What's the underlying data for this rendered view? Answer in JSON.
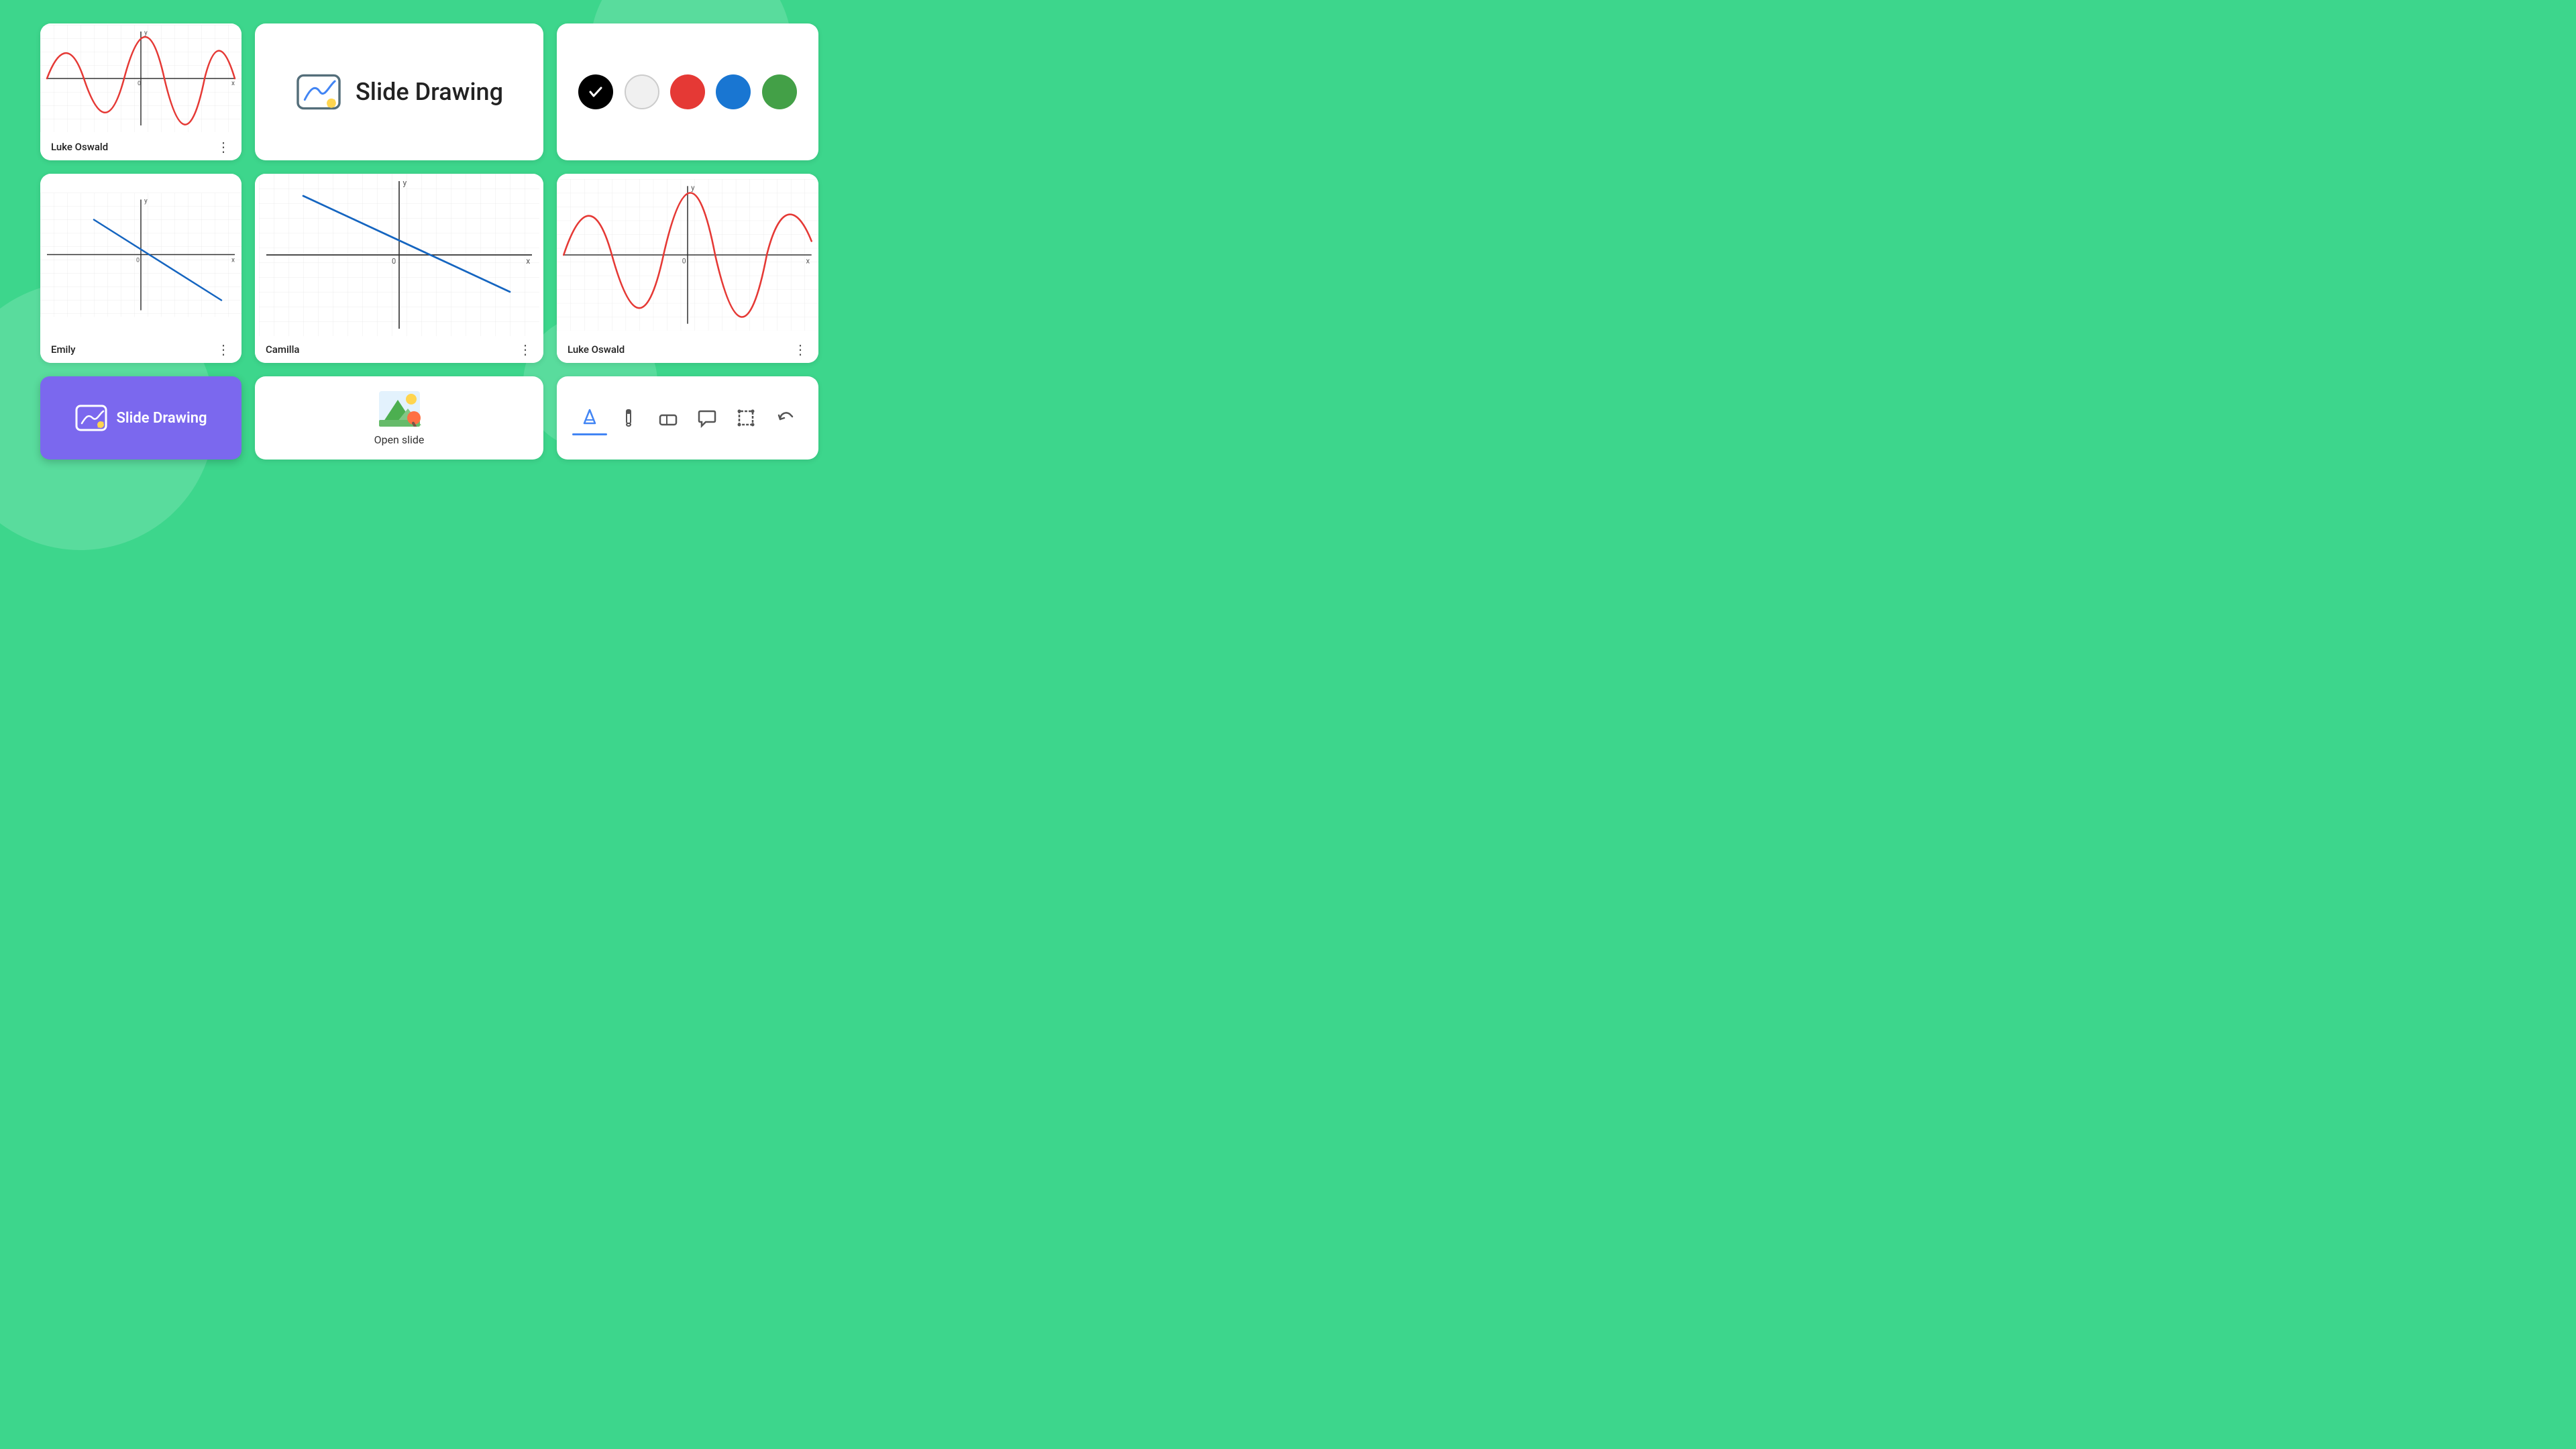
{
  "background_color": "#3dd68c",
  "cards": {
    "luke_oswald_small": {
      "name": "Luke Oswald",
      "graph_type": "sine_wave",
      "color": "#e53935"
    },
    "emily": {
      "name": "Emily",
      "graph_type": "linear_negative",
      "color": "#1565C0"
    },
    "slide_drawing_header": {
      "title": "Slide Drawing"
    },
    "camilla": {
      "name": "Camilla",
      "graph_type": "linear_negative",
      "color": "#1565C0"
    },
    "open_slide": {
      "label": "Open slide"
    },
    "color_picker": {
      "colors": [
        "#000000",
        "#e8e8e8",
        "#e53935",
        "#1976D2",
        "#43A047"
      ],
      "selected_index": 0
    },
    "luke_oswald_large": {
      "name": "Luke Oswald",
      "graph_type": "sine_wave",
      "color": "#e53935"
    },
    "tools": {
      "items": [
        {
          "name": "pencil",
          "label": "pencil-tool",
          "active": true
        },
        {
          "name": "marker",
          "label": "marker-tool",
          "active": false
        },
        {
          "name": "eraser",
          "label": "eraser-tool",
          "active": false
        },
        {
          "name": "speech-bubble",
          "label": "speech-bubble-tool",
          "active": false
        },
        {
          "name": "transform",
          "label": "transform-tool",
          "active": false
        },
        {
          "name": "undo",
          "label": "undo-tool",
          "active": false
        }
      ]
    },
    "slide_drawing_button": {
      "label": "Slide Drawing"
    }
  }
}
